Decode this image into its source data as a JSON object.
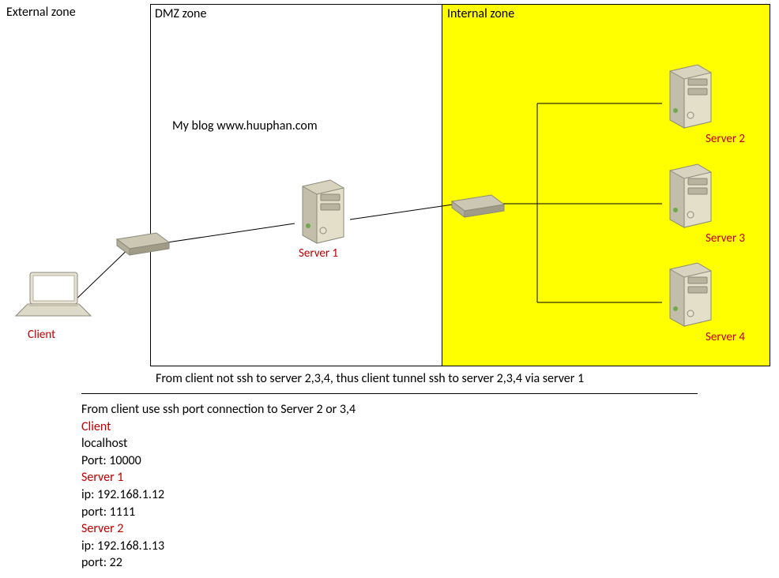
{
  "zones": {
    "external": "External zone",
    "dmz": "DMZ zone",
    "internal": "Internal zone"
  },
  "blog_text": "My blog www.huuphan.com",
  "nodes": {
    "client": "Client",
    "server1": "Server 1",
    "server2": "Server 2",
    "server3": "Server 3",
    "server4": "Server 4"
  },
  "caption_line": "From client not ssh to server 2,3,4, thus client tunnel ssh to server 2,3,4 via server 1",
  "info_title": "From client use ssh port connection to Server 2 or 3,4",
  "info": {
    "client_heading": "Client",
    "client_host": "localhost",
    "client_port": "Port: 10000",
    "server1_heading": "Server 1",
    "server1_ip": "ip: 192.168.1.12",
    "server1_port": "port: 1111",
    "server2_heading": "Server 2",
    "server2_ip": "ip: 192.168.1.13",
    "server2_port": "port: 22"
  }
}
